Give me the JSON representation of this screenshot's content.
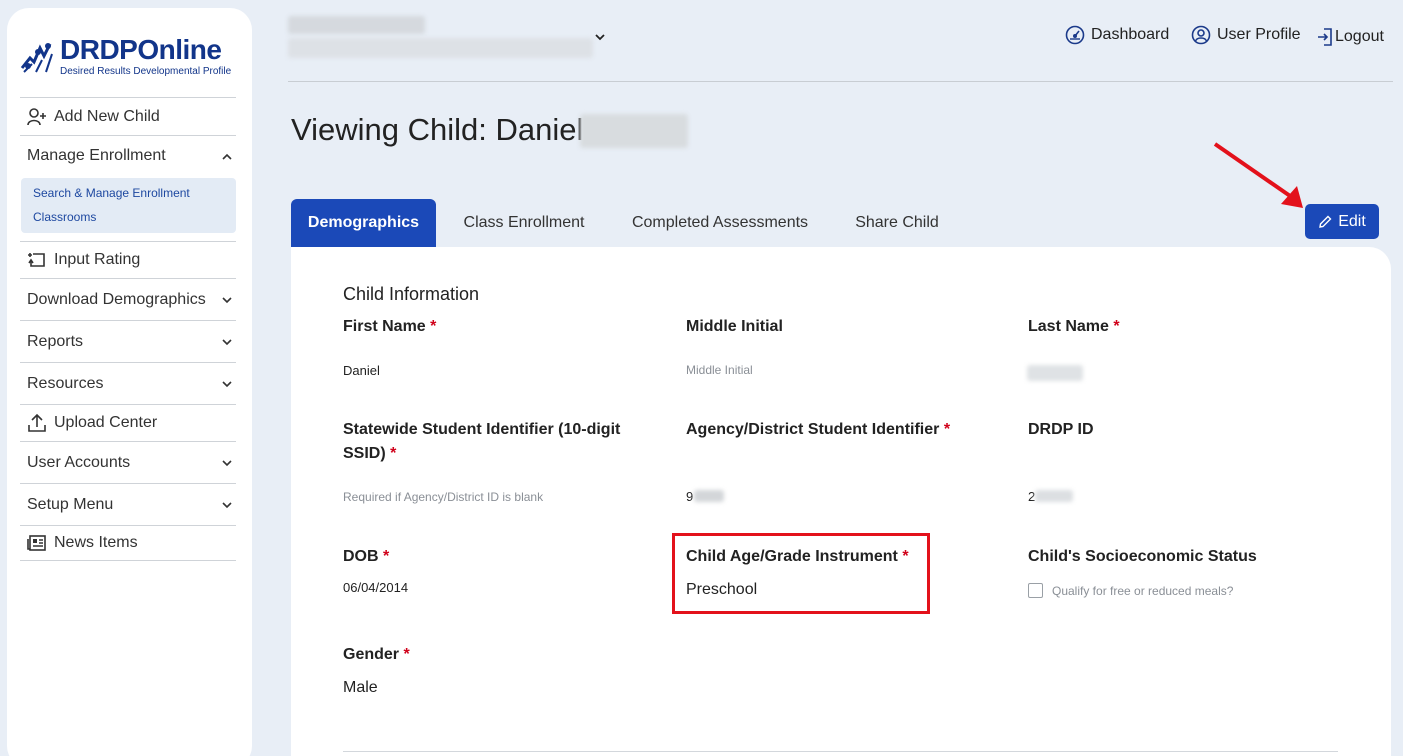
{
  "logo": {
    "title": "DRDPOnline",
    "tagline": "Desired Results Developmental Profile"
  },
  "sidebar": {
    "items": [
      {
        "label": "Add New Child",
        "icon": "add-person-icon"
      },
      {
        "label": "Manage Enrollment",
        "icon": "chevron-up-icon",
        "submenu": [
          "Search & Manage Enrollment",
          "Classrooms"
        ]
      },
      {
        "label": "Input Rating",
        "icon": "input-rating-icon"
      },
      {
        "label": "Download Demographics",
        "icon": "chevron-down-icon"
      },
      {
        "label": "Reports",
        "icon": "chevron-down-icon"
      },
      {
        "label": "Resources",
        "icon": "chevron-down-icon"
      },
      {
        "label": "Upload Center",
        "icon": "upload-icon"
      },
      {
        "label": "User Accounts",
        "icon": "chevron-down-icon"
      },
      {
        "label": "Setup Menu",
        "icon": "chevron-down-icon"
      },
      {
        "label": "News Items",
        "icon": "news-icon"
      }
    ]
  },
  "header": {
    "nav": [
      {
        "label": "Dashboard",
        "icon": "dashboard-icon"
      },
      {
        "label": "User Profile",
        "icon": "user-circle-icon"
      },
      {
        "label": "Logout",
        "icon": "logout-icon"
      }
    ]
  },
  "page": {
    "title": "Viewing Child: Daniel"
  },
  "tabs": [
    {
      "label": "Demographics",
      "active": true
    },
    {
      "label": "Class Enrollment",
      "active": false
    },
    {
      "label": "Completed Assessments",
      "active": false
    },
    {
      "label": "Share Child",
      "active": false
    }
  ],
  "edit_button": {
    "label": "Edit",
    "icon": "pencil-icon"
  },
  "form": {
    "section_title": "Child Information",
    "required_mark": "*",
    "first_name": {
      "label": "First Name",
      "value": "Daniel"
    },
    "middle_initial": {
      "label": "Middle Initial",
      "placeholder": "Middle Initial"
    },
    "last_name": {
      "label": "Last Name"
    },
    "ssid": {
      "label": "Statewide Student Identifier (10-digit SSID)",
      "placeholder": "Required if Agency/District ID is blank"
    },
    "agency_id": {
      "label": "Agency/District Student Identifier",
      "value_prefix": "9"
    },
    "drdp_id": {
      "label": "DRDP ID",
      "value_prefix": "2"
    },
    "dob": {
      "label": "DOB",
      "value": "06/04/2014"
    },
    "instrument": {
      "label": "Child Age/Grade Instrument",
      "value": "Preschool"
    },
    "socioeconomic": {
      "label": "Child's Socioeconomic Status",
      "checkbox_label": "Qualify for free or reduced meals?"
    },
    "gender": {
      "label": "Gender",
      "value": "Male"
    }
  },
  "colors": {
    "primary": "#1b49b8",
    "highlight": "#e3111b",
    "required": "#d0021b",
    "background": "#e8eef6"
  }
}
